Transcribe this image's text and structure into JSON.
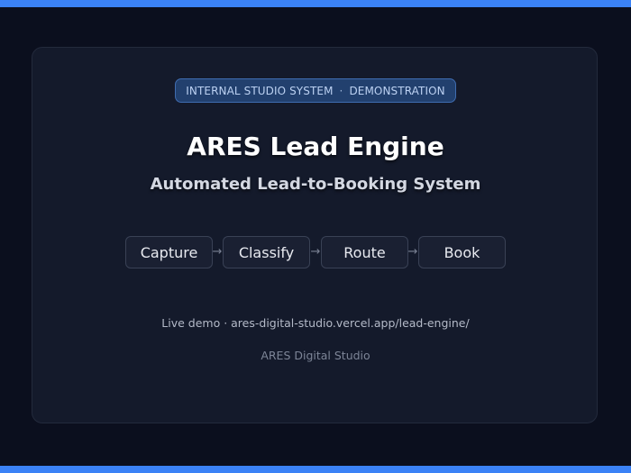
{
  "badge": {
    "left": "INTERNAL STUDIO SYSTEM",
    "separator": "·",
    "right": "DEMONSTRATION"
  },
  "title": "ARES Lead Engine",
  "subtitle": "Automated Lead-to-Booking System",
  "flow": {
    "steps": [
      "Capture",
      "Classify",
      "Route",
      "Book"
    ],
    "arrow": "→"
  },
  "demo_link": "Live demo · ares-digital-studio.vercel.app/lead-engine/",
  "footer": "ARES Digital Studio",
  "colors": {
    "accent_bar": "#3b82f6",
    "background": "#0b0f1e",
    "card": "#141a2b",
    "badge_bg": "#22406e"
  }
}
